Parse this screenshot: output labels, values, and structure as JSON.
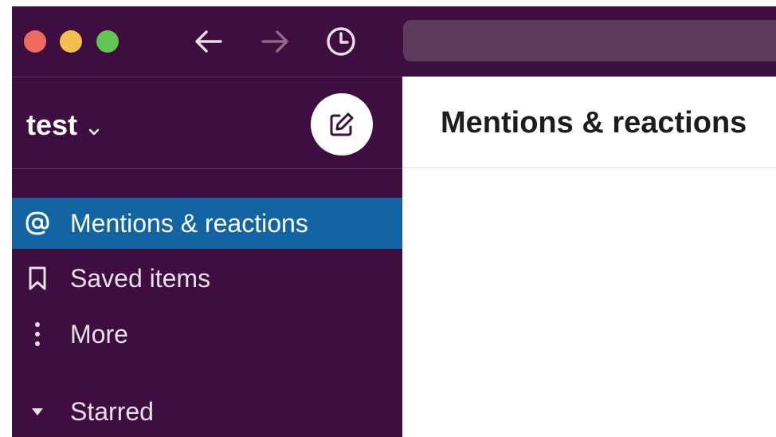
{
  "workspace": {
    "name": "test"
  },
  "sidebar": {
    "items": [
      {
        "label": "Mentions & reactions",
        "icon": "at-icon",
        "active": true
      },
      {
        "label": "Saved items",
        "icon": "bookmark-icon",
        "active": false
      },
      {
        "label": "More",
        "icon": "more-vertical-icon",
        "active": false
      },
      {
        "label": "Starred",
        "icon": "caret-down-icon",
        "active": false
      }
    ]
  },
  "main": {
    "title": "Mentions & reactions"
  },
  "colors": {
    "sidebar_bg": "#3f0e40",
    "active_item": "#1264a3",
    "close": "#ed6a5e",
    "minimize": "#f5bf4f",
    "zoom": "#61c554"
  }
}
